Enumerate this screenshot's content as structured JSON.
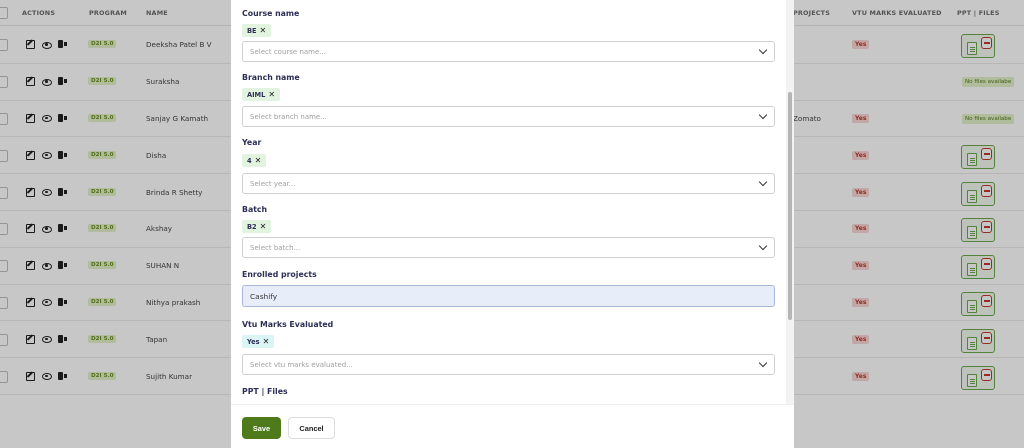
{
  "table": {
    "headers": {
      "actions": "ACTIONS",
      "program": "PROGRAM",
      "name": "NAME",
      "projects": "PROJECTS",
      "vtu": "VTU MARKS EVALUATED",
      "files": "PPT | FILES"
    },
    "rows": [
      {
        "program": "D2I 5.0",
        "name": "Deeksha Patel B V",
        "project": "",
        "vtu": "Yes",
        "files": "icons"
      },
      {
        "program": "D2I 5.0",
        "name": "Suraksha",
        "project": "",
        "vtu": "",
        "files": "none",
        "files_text": "No files availabe"
      },
      {
        "program": "D2I 5.0",
        "name": "Sanjay G Kamath",
        "project": "Zomato",
        "vtu": "Yes",
        "files": "none",
        "files_text": "No files availabe"
      },
      {
        "program": "D2I 5.0",
        "name": "Disha",
        "project": "",
        "vtu": "Yes",
        "files": "icons"
      },
      {
        "program": "D2I 5.0",
        "name": "Brinda R Shetty",
        "project": "",
        "vtu": "Yes",
        "files": "icons"
      },
      {
        "program": "D2I 5.0",
        "name": "Akshay",
        "project": "",
        "vtu": "Yes",
        "files": "icons"
      },
      {
        "program": "D2I 5.0",
        "name": "SUHAN N",
        "project": "",
        "vtu": "Yes",
        "files": "icons"
      },
      {
        "program": "D2I 5.0",
        "name": "Nithya prakash",
        "project": "",
        "vtu": "Yes",
        "files": "icons"
      },
      {
        "program": "D2I 5.0",
        "name": "Tapan",
        "project": "",
        "vtu": "Yes",
        "files": "icons"
      },
      {
        "program": "D2I 5.0",
        "name": "Sujith Kumar",
        "project": "",
        "vtu": "Yes",
        "files": "icons"
      }
    ]
  },
  "modal": {
    "course": {
      "label": "Course name",
      "chip": "BE",
      "placeholder": "Select course name..."
    },
    "branch": {
      "label": "Branch name",
      "chip": "AIML",
      "placeholder": "Select branch name..."
    },
    "year": {
      "label": "Year",
      "chip": "4",
      "placeholder": "Select year..."
    },
    "batch": {
      "label": "Batch",
      "chip": "B2",
      "placeholder": "Select batch..."
    },
    "projects": {
      "label": "Enrolled projects",
      "value": "Cashify"
    },
    "vtu": {
      "label": "Vtu Marks Evaluated",
      "chip": "Yes",
      "placeholder": "Select vtu marks evaluated..."
    },
    "files": {
      "label": "PPT | Files"
    },
    "save_label": "Save",
    "cancel_label": "Cancel"
  },
  "colors": {
    "accent": "#4f7a1c",
    "chip_green": "#e2f3e0",
    "chip_cyan": "#d9f5f5",
    "badge_red": "#f8d7d5"
  }
}
